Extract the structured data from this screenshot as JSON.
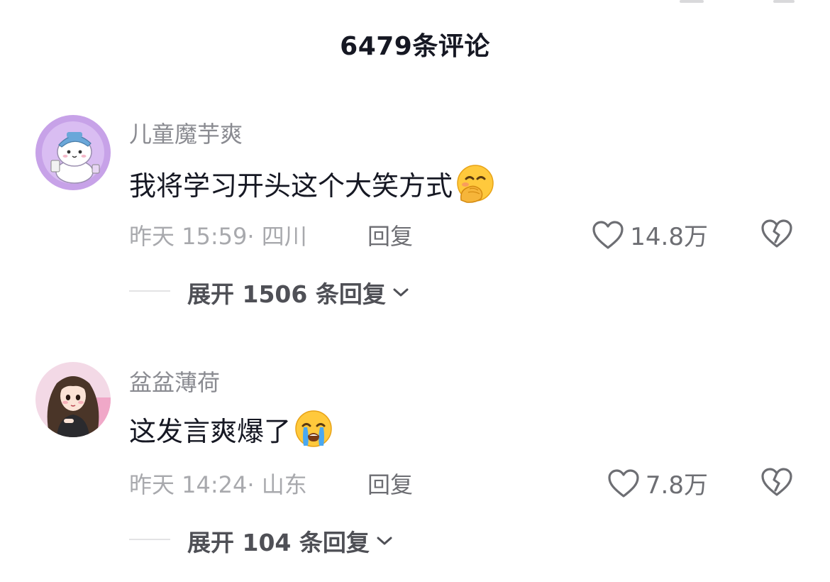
{
  "header": {
    "title": "6479条评论"
  },
  "comments": [
    {
      "username": "儿童魔芋爽",
      "text": "我将学习开头这个大笑方式",
      "emoji": "face-with-hand-over-mouth-emoji",
      "time": "昨天 15:59",
      "location": "· 四川",
      "reply_label": "回复",
      "likes": "14.8万",
      "expand_label": "展开 1506 条回复"
    },
    {
      "username": "盆盆薄荷",
      "text": "这发言爽爆了",
      "emoji": "loudly-crying-face-emoji",
      "time": "昨天 14:24",
      "location": "· 山东",
      "reply_label": "回复",
      "likes": "7.8万",
      "expand_label": "展开 104 条回复"
    }
  ],
  "icons": {
    "like": "heart-outline-icon",
    "dislike": "broken-heart-outline-icon",
    "expand": "chevron-down-icon"
  },
  "colors": {
    "text": "#161823",
    "username": "#8a8b91",
    "meta": "#a8a9ad",
    "action": "#6d6e73"
  }
}
